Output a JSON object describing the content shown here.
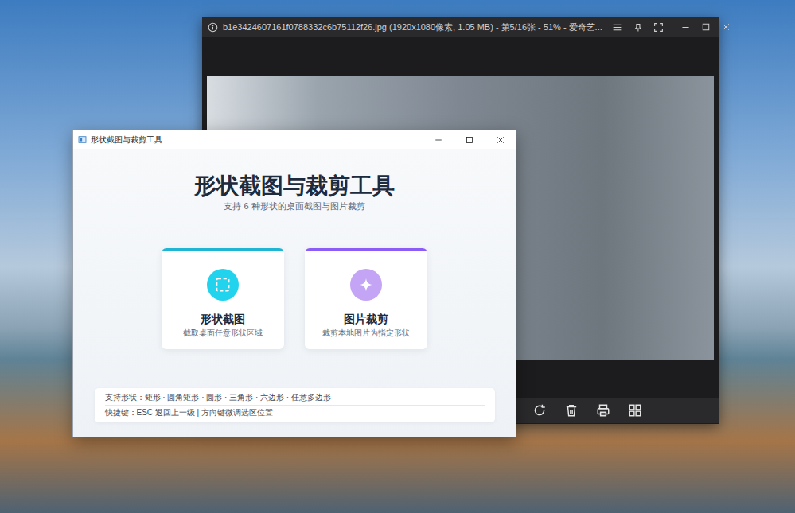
{
  "viewer": {
    "title": "b1e3424607161f0788332c6b75112f26.jpg (1920x1080像素, 1.05 MB) - 第5/16张 - 51% - 爱奇艺..."
  },
  "app": {
    "title": "形状截图与裁剪工具",
    "heading": "形状截图与裁剪工具",
    "subtitle": "支持 6 种形状的桌面截图与图片裁剪",
    "cards": [
      {
        "kind": "capture",
        "title": "形状截图",
        "description": "截取桌面任意形状区域",
        "color": "#1fb5d3",
        "icon_color": "#22d3ee"
      },
      {
        "kind": "crop",
        "title": "图片裁剪",
        "description": "裁剪本地图片为指定形状",
        "color": "#8b5cf6",
        "icon_color": "#c4a5f5"
      }
    ],
    "info": [
      "支持形状：矩形 · 圆角矩形 · 圆形 · 三角形 · 六边形 · 任意多边形",
      "快捷键：ESC 返回上一级 | 方向键微调选区位置"
    ]
  }
}
